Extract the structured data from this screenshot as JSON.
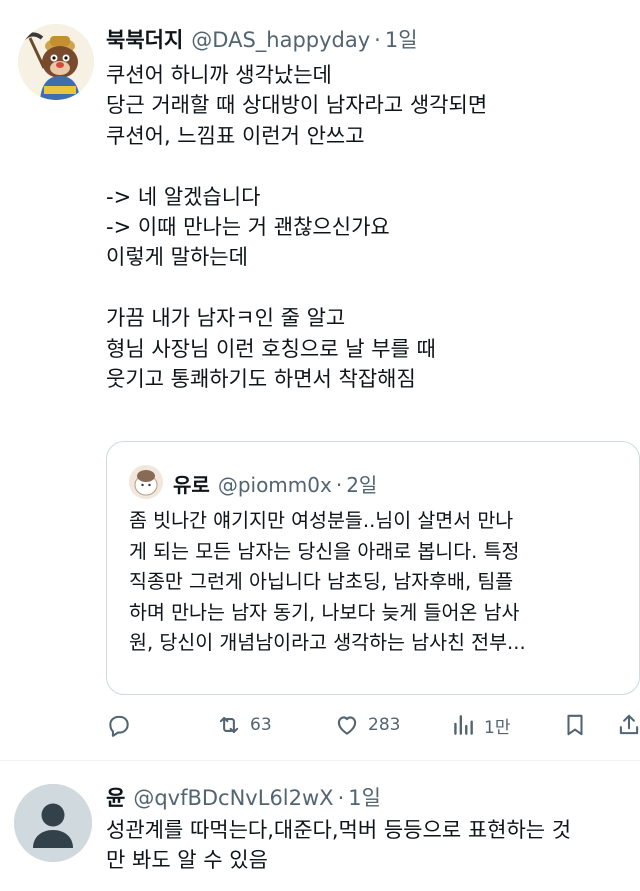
{
  "tweet1": {
    "display_name": "북북더지",
    "handle": "@DAS_happyday",
    "separator": "·",
    "time": "1일",
    "text": "쿠션어 하니까 생각났는데\n당근 거래할 때 상대방이 남자라고 생각되면\n쿠션어, 느낌표 이런거 안쓰고\n\n-> 네 알겠습니다\n-> 이때 만나는 거 괜찮으신가요\n이렇게 말하는데\n\n가끔 내가 남자ㅋ인 줄 알고\n형님 사장님 이런 호칭으로 날 부를 때\n웃기고 통쾌하기도 하면서 착잡해짐",
    "quote": {
      "display_name": "유로",
      "handle": "@piomm0x",
      "separator": "·",
      "time": "2일",
      "text": "좀 빗나간 얘기지만 여성분들..님이 살면서 만나\n게 되는 모든 남자는 당신을 아래로 봅니다. 특정\n직종만 그런게 아닙니다 남초딩, 남자후배, 팀플\n하며 만나는 남자 동기, 나보다 늦게 들어온 남사\n원, 당신이 개념남이라고 생각하는 남사친 전부..."
    },
    "actions": {
      "reply_icon": "reply-icon",
      "retweet_count": "63",
      "like_count": "283",
      "views_count": "1만"
    }
  },
  "tweet2": {
    "display_name": "윤",
    "handle": "@qvfBDcNvL6l2wX",
    "separator": "·",
    "time": "1일",
    "text": "성관계를 따먹는다,대준다,먹버 등등으로 표현하는 것\n만 봐도 알 수 있음"
  },
  "colors": {
    "text": "#0f1419",
    "secondary": "#536471",
    "border": "#cfd9de"
  }
}
